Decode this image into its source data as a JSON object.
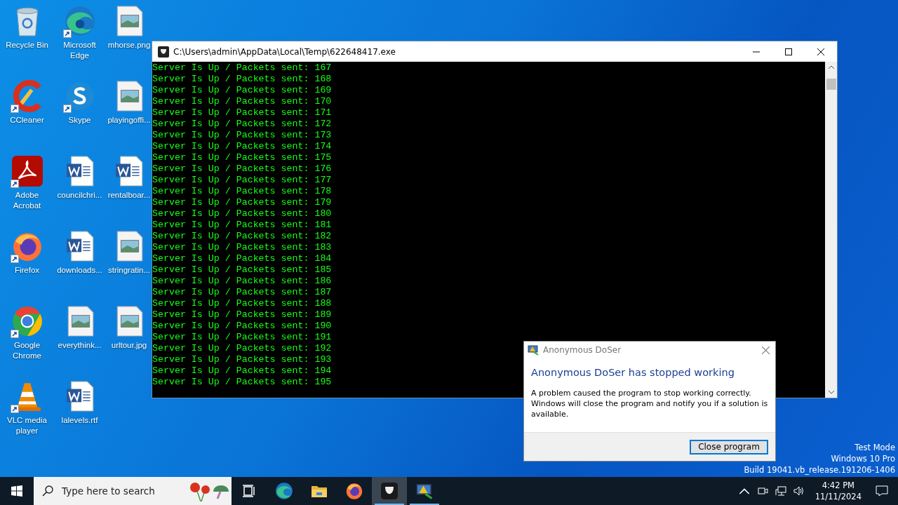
{
  "desktop": {
    "columns": [
      [
        {
          "label": "Recycle Bin",
          "kind": "recycle",
          "shortcut": false
        },
        {
          "label": "CCleaner",
          "kind": "ccleaner",
          "shortcut": true
        },
        {
          "label": "Adobe Acrobat",
          "kind": "acrobat",
          "shortcut": true
        },
        {
          "label": "Firefox",
          "kind": "firefox",
          "shortcut": true
        },
        {
          "label": "Google Chrome",
          "kind": "chrome",
          "shortcut": true
        },
        {
          "label": "VLC media player",
          "kind": "vlc",
          "shortcut": true
        }
      ],
      [
        {
          "label": "Microsoft Edge",
          "kind": "edge",
          "shortcut": true
        },
        {
          "label": "Skype",
          "kind": "skype",
          "shortcut": true
        },
        {
          "label": "councilchri...",
          "kind": "word",
          "shortcut": false
        },
        {
          "label": "downloads...",
          "kind": "word",
          "shortcut": false
        },
        {
          "label": "everythink...",
          "kind": "image",
          "shortcut": false
        },
        {
          "label": "lalevels.rtf",
          "kind": "word",
          "shortcut": false
        }
      ],
      [
        {
          "label": "mhorse.png",
          "kind": "image",
          "shortcut": false
        },
        {
          "label": "playingoffi...",
          "kind": "image",
          "shortcut": false
        },
        {
          "label": "rentalboar...",
          "kind": "word",
          "shortcut": false
        },
        {
          "label": "stringratin...",
          "kind": "image",
          "shortcut": false
        },
        {
          "label": "urltour.jpg",
          "kind": "image",
          "shortcut": false
        }
      ]
    ],
    "watermark": [
      "Test Mode",
      "Windows 10 Pro",
      "Build 19041.vb_release.191206-1406"
    ]
  },
  "console": {
    "title": "C:\\Users\\admin\\AppData\\Local\\Temp\\622648417.exe",
    "lines": [
      "Server Is Up / Packets sent: 167",
      "Server Is Up / Packets sent: 168",
      "Server Is Up / Packets sent: 169",
      "Server Is Up / Packets sent: 170",
      "Server Is Up / Packets sent: 171",
      "Server Is Up / Packets sent: 172",
      "Server Is Up / Packets sent: 173",
      "Server Is Up / Packets sent: 174",
      "Server Is Up / Packets sent: 175",
      "Server Is Up / Packets sent: 176",
      "Server Is Up / Packets sent: 177",
      "Server Is Up / Packets sent: 178",
      "Server Is Up / Packets sent: 179",
      "Server Is Up / Packets sent: 180",
      "Server Is Up / Packets sent: 181",
      "Server Is Up / Packets sent: 182",
      "Server Is Up / Packets sent: 183",
      "Server Is Up / Packets sent: 184",
      "Server Is Up / Packets sent: 185",
      "Server Is Up / Packets sent: 186",
      "Server Is Up / Packets sent: 187",
      "Server Is Up / Packets sent: 188",
      "Server Is Up / Packets sent: 189",
      "Server Is Up / Packets sent: 190",
      "Server Is Up / Packets sent: 191",
      "Server Is Up / Packets sent: 192",
      "Server Is Up / Packets sent: 193",
      "Server Is Up / Packets sent: 194",
      "Server Is Up / Packets sent: 195"
    ]
  },
  "dialog": {
    "title": "Anonymous DoSer",
    "heading": "Anonymous DoSer has stopped working",
    "message": "A problem caused the program to stop working correctly. Windows will close the program and notify you if a solution is available.",
    "button": "Close program"
  },
  "taskbar": {
    "search": {
      "placeholder": "Type here to search"
    },
    "apps": [
      {
        "kind": "taskview",
        "running": false,
        "selected": false
      },
      {
        "kind": "edge",
        "running": false,
        "selected": false
      },
      {
        "kind": "folder",
        "running": false,
        "selected": false
      },
      {
        "kind": "firefox",
        "running": false,
        "selected": false
      },
      {
        "kind": "mask",
        "running": true,
        "selected": true
      },
      {
        "kind": "monitor",
        "running": true,
        "selected": false
      }
    ],
    "time": "4:42 PM",
    "date": "11/11/2024"
  }
}
